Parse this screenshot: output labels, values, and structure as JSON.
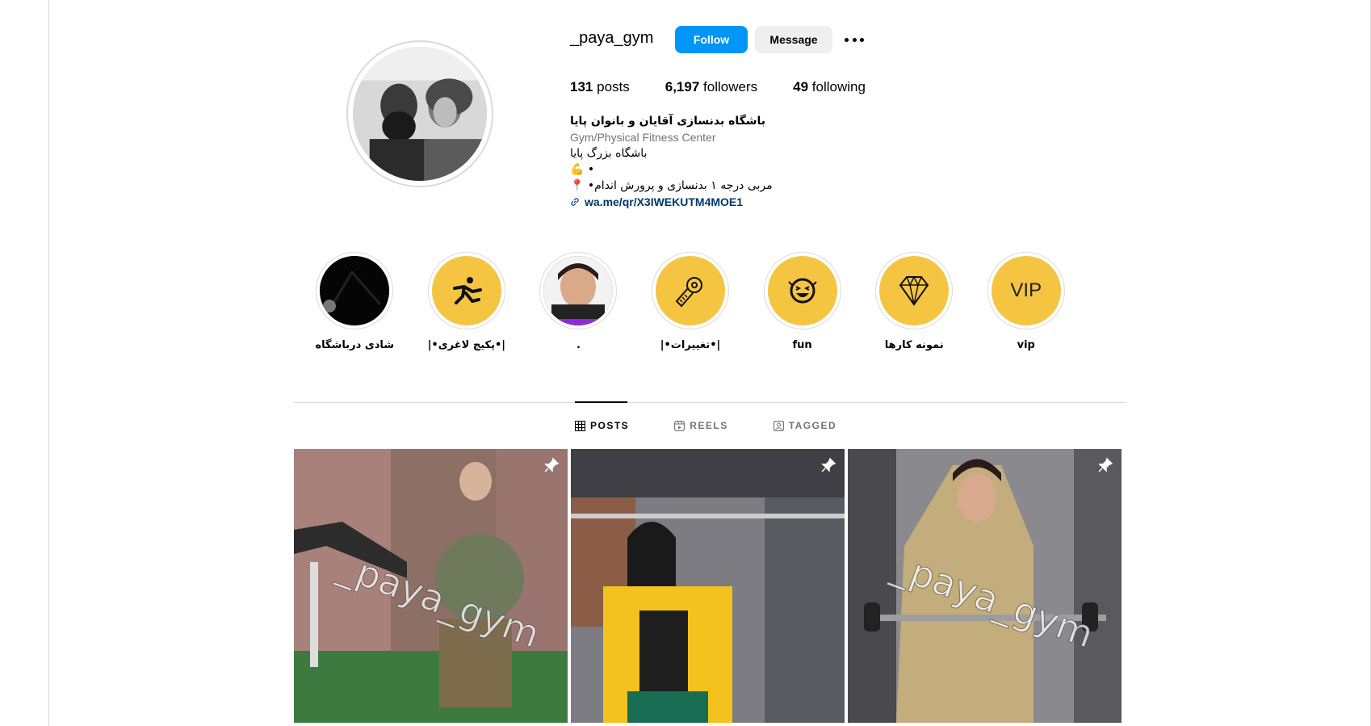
{
  "profile": {
    "username": "_paya_gym",
    "follow_label": "Follow",
    "message_label": "Message",
    "posts_count": "131",
    "posts_label": "posts",
    "followers_count": "6,197",
    "followers_label": "followers",
    "following_count": "49",
    "following_label": "following",
    "bio_name": "باشگاه بدنسازی آقایان و بانوان پایا",
    "bio_category": "Gym/Physical Fitness Center",
    "bio_line1": "باشگاه بزرگ پایا",
    "bio_line2": "💪 •",
    "bio_line3": "📍 •مربی درجه ۱ بدنسازی و پرورش اندام",
    "bio_link": "wa.me/qr/X3IWEKUTM4MOE1"
  },
  "highlights": [
    {
      "label": "شادی درباشگاه",
      "style": "dark"
    },
    {
      "label": "|•پکیج لاغری•|",
      "style": "yellow",
      "icon": "runner-icon"
    },
    {
      "label": ".",
      "style": "photo"
    },
    {
      "label": "|•تغییرات•|",
      "style": "yellow",
      "icon": "measuring-tape-icon"
    },
    {
      "label": "fun",
      "style": "yellow",
      "icon": "laughing-face-icon"
    },
    {
      "label": "نمونه کارها",
      "style": "yellow",
      "icon": "diamond-icon"
    },
    {
      "label": "vip",
      "style": "yellow",
      "icon": "vip-text-icon",
      "icon_text": "VIP"
    }
  ],
  "tabs": [
    {
      "label": "POSTS",
      "active": true
    },
    {
      "label": "REELS",
      "active": false
    },
    {
      "label": "TAGGED",
      "active": false
    }
  ],
  "posts": [
    {
      "watermark": "_paya_gym",
      "pinned": true
    },
    {
      "watermark": "",
      "pinned": true
    },
    {
      "watermark": "_paya_gym",
      "pinned": true
    }
  ],
  "colors": {
    "follow_button": "#0095f6",
    "highlight_yellow": "#f5c542",
    "link": "#00376b"
  }
}
